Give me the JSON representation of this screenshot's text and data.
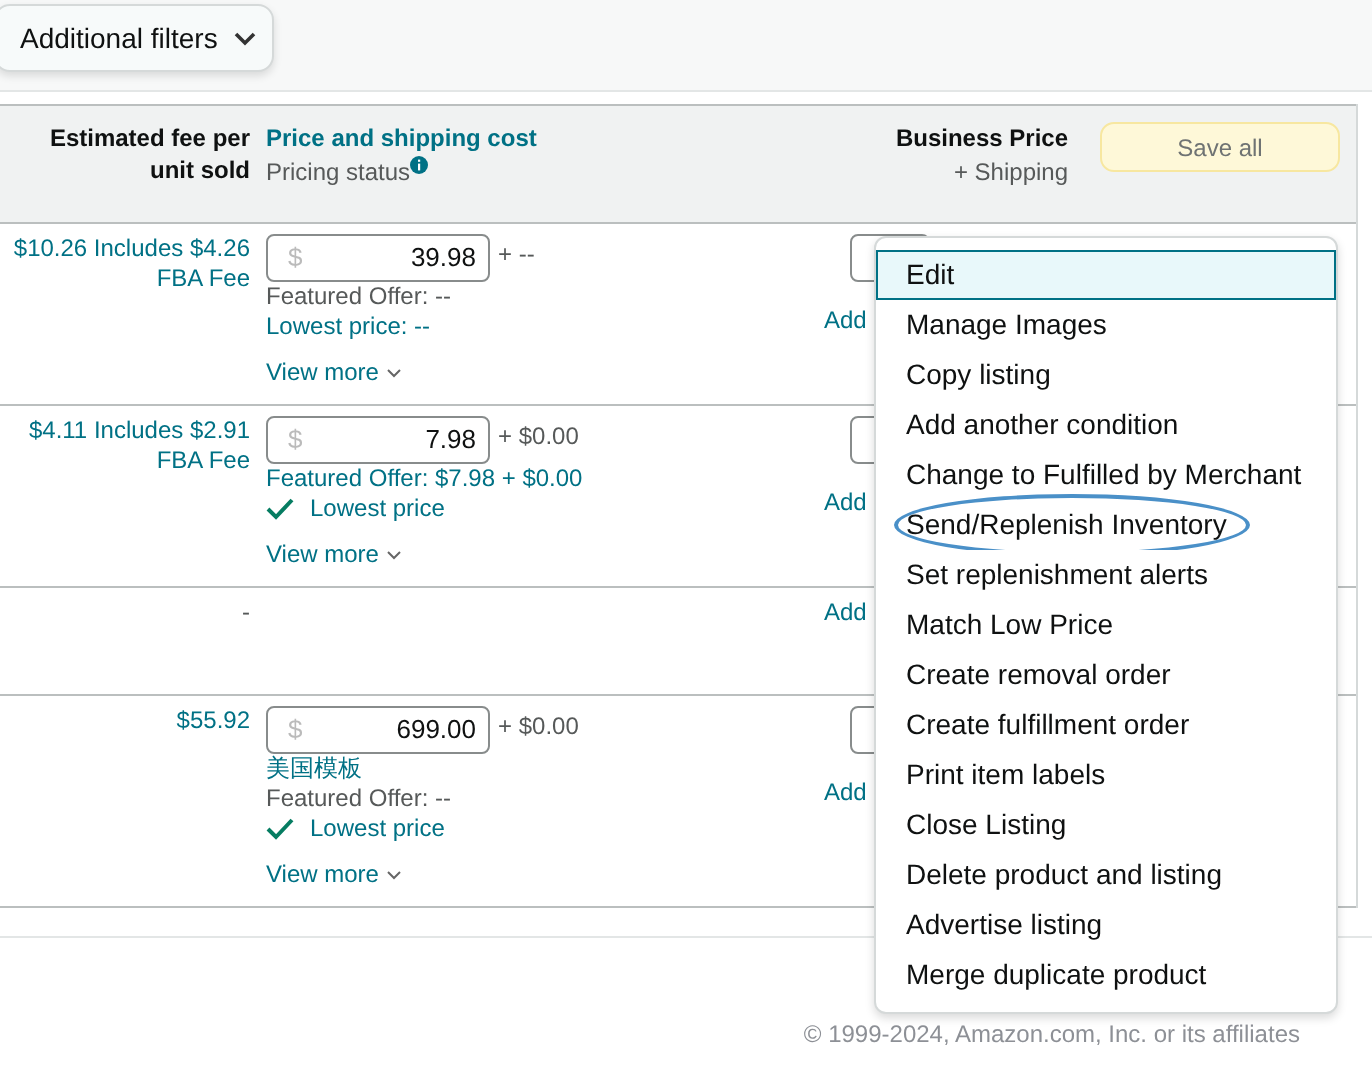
{
  "filters_button": {
    "label": "Additional filters"
  },
  "header": {
    "fee": "Estimated fee per unit sold",
    "price_title": "Price and shipping cost",
    "price_sub": "Pricing status",
    "business_title": "Business Price",
    "business_sub": "+ Shipping",
    "save": "Save all"
  },
  "rows": [
    {
      "fee": "$10.26 Includes $4.26 FBA Fee",
      "price": "39.98",
      "currency": "$",
      "shipping": "+ --",
      "lines": [
        {
          "kind": "note",
          "text": "Featured Offer: --"
        },
        {
          "kind": "link",
          "text": "Lowest price: --"
        }
      ],
      "view_more": "View more",
      "add": "Add",
      "business_field": true
    },
    {
      "fee": "$4.11 Includes $2.91 FBA Fee",
      "price": "7.98",
      "currency": "$",
      "shipping": "+ $0.00",
      "lines": [
        {
          "kind": "link",
          "text": "Featured Offer: $7.98 + $0.00"
        },
        {
          "kind": "check",
          "text": "Lowest price"
        }
      ],
      "view_more": "View more",
      "add": "Add",
      "business_field": true
    },
    {
      "fee": "-",
      "add": "Add",
      "business_field": false
    },
    {
      "fee": "$55.92",
      "price": "699.00",
      "currency": "$",
      "shipping": "+ $0.00",
      "lines": [
        {
          "kind": "link",
          "text": "美国模板"
        },
        {
          "kind": "note",
          "text": "Featured Offer: --"
        },
        {
          "kind": "check",
          "text": "Lowest price"
        }
      ],
      "view_more": "View more",
      "add": "Add",
      "business_field": true
    }
  ],
  "menu": [
    {
      "label": "Edit",
      "selected": true,
      "circled": false
    },
    {
      "label": "Manage Images",
      "selected": false,
      "circled": false
    },
    {
      "label": "Copy listing",
      "selected": false,
      "circled": false
    },
    {
      "label": "Add another condition",
      "selected": false,
      "circled": false
    },
    {
      "label": "Change to Fulfilled by Merchant",
      "selected": false,
      "circled": false
    },
    {
      "label": "Send/Replenish Inventory",
      "selected": false,
      "circled": true
    },
    {
      "label": "Set replenishment alerts",
      "selected": false,
      "circled": false
    },
    {
      "label": "Match Low Price",
      "selected": false,
      "circled": false
    },
    {
      "label": "Create removal order",
      "selected": false,
      "circled": false
    },
    {
      "label": "Create fulfillment order",
      "selected": false,
      "circled": false
    },
    {
      "label": "Print item labels",
      "selected": false,
      "circled": false
    },
    {
      "label": "Close Listing",
      "selected": false,
      "circled": false
    },
    {
      "label": "Delete product and listing",
      "selected": false,
      "circled": false
    },
    {
      "label": "Advertise listing",
      "selected": false,
      "circled": false
    },
    {
      "label": "Merge duplicate product",
      "selected": false,
      "circled": false
    }
  ],
  "footer": "© 1999-2024, Amazon.com, Inc. or its affiliates"
}
